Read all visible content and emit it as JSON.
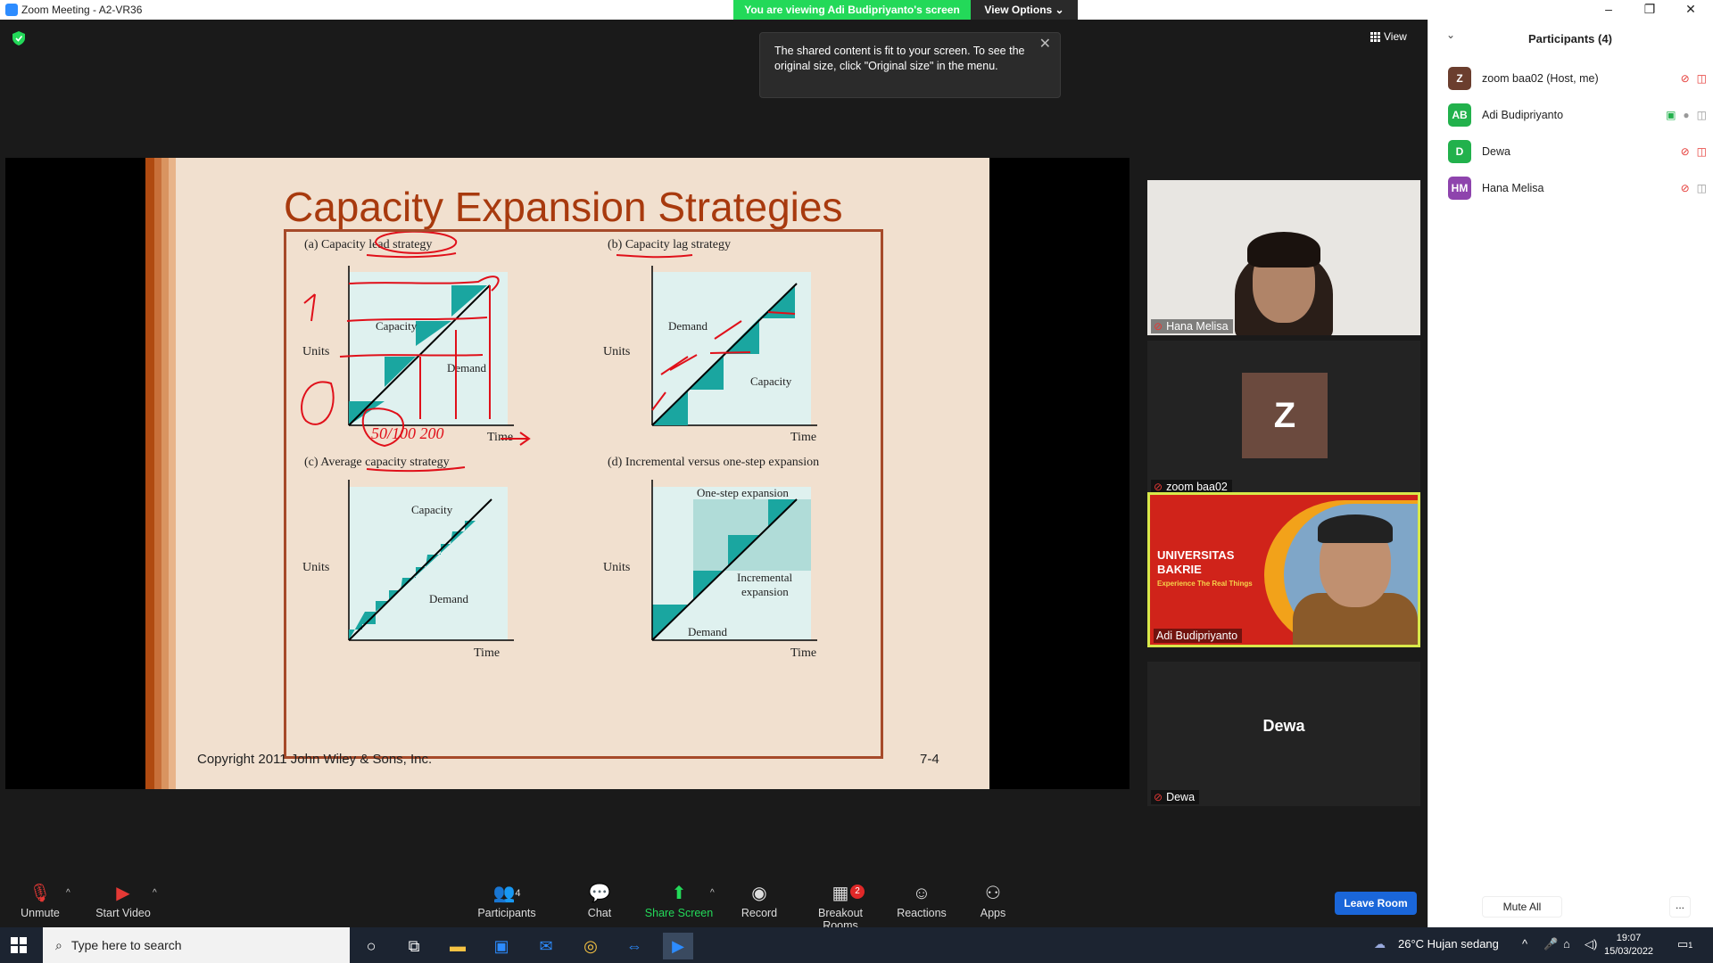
{
  "window": {
    "title": "Zoom Meeting - A2-VR36",
    "minimize": "–",
    "restore": "❐",
    "close": "✕"
  },
  "share_banner": {
    "text": "You are viewing Adi Budipriyanto's screen",
    "view_options": "View Options ⌄"
  },
  "view_button": {
    "label": "View"
  },
  "toast": {
    "text": "The shared content is fit to your screen. To see the original size, click \"Original size\" in the menu.",
    "close": "✕"
  },
  "slide": {
    "title": "Capacity Expansion Strategies",
    "copyright": "Copyright 2011 John Wiley & Sons, Inc.",
    "page": "7-4",
    "panels": {
      "a_title": "(a)  Capacity lead strategy",
      "b_title": "(b)  Capacity lag strategy",
      "c_title": "(c)  Average capacity strategy",
      "d_title": "(d)  Incremental versus one-step expansion",
      "units": "Units",
      "time": "Time",
      "capacity": "Capacity",
      "demand": "Demand",
      "one_step": "One-step expansion",
      "incremental_1": "Incremental",
      "incremental_2": "expansion",
      "handwriting": "50/100 200"
    }
  },
  "videos": {
    "hana": {
      "name": "Hana Melisa"
    },
    "zoom": {
      "name": "zoom baa02",
      "avatar": "Z"
    },
    "adi": {
      "name": "Adi Budipriyanto",
      "banner_1": "UNIVERSITAS",
      "banner_2": "BAKRIE",
      "banner_3": "Experience The Real Things"
    },
    "dewa": {
      "name": "Dewa"
    }
  },
  "participants": {
    "title": "Participants (4)",
    "list": [
      {
        "initials": "Z",
        "name": "zoom baa02 (Host, me)",
        "color": "#6b3e2e"
      },
      {
        "initials": "AB",
        "name": "Adi Budipriyanto",
        "color": "#22b14c"
      },
      {
        "initials": "D",
        "name": "Dewa",
        "color": "#22b14c"
      },
      {
        "initials": "HM",
        "name": "Hana Melisa",
        "color": "#8e44ad"
      }
    ],
    "mute_all": "Mute All",
    "more": "..."
  },
  "toolbar": {
    "unmute": "Unmute",
    "start_video": "Start Video",
    "participants": "Participants",
    "participants_count": "4",
    "chat": "Chat",
    "share_screen": "Share Screen",
    "record": "Record",
    "breakout": "Breakout Rooms",
    "breakout_badge": "2",
    "reactions": "Reactions",
    "apps": "Apps",
    "leave": "Leave Room"
  },
  "taskbar": {
    "search_placeholder": "Type here to search",
    "weather": "26°C  Hujan sedang",
    "time": "19:07",
    "date": "15/03/2022",
    "notif_count": "1"
  }
}
